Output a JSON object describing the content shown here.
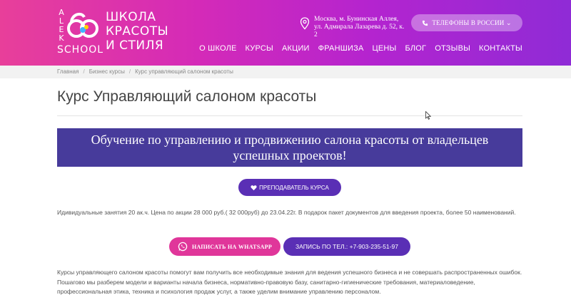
{
  "header": {
    "logo": {
      "vertical_letters": [
        "A",
        "L",
        "E",
        "K"
      ],
      "school": "SCHOOL",
      "title_lines": [
        "ШКОЛА",
        "КРАСОТЫ",
        "И СТИЛЯ"
      ]
    },
    "address": "Москва, м. Бунинская Аллея, ул. Адмирала Лазарева д. 52, к. 2",
    "phones_button": "ТЕЛЕФОНЫ В РОССИИ ⌄",
    "nav": [
      "О ШКОЛЕ",
      "КУРСЫ",
      "АКЦИИ",
      "ФРАНШИЗА",
      "ЦЕНЫ",
      "БЛОГ",
      "ОТЗЫВЫ",
      "КОНТАКТЫ"
    ]
  },
  "breadcrumbs": [
    "Главная",
    "Бизнес курсы",
    "Курс управляющий салоном красоты"
  ],
  "page_title": "Курс Управляющий салоном красоты",
  "banner": "Обучение по управлению и продвижению салона красоты от владельцев успешных проектов!",
  "teacher_button": "ПРЕПОДАВАТЕЛЬ КУРСА",
  "offer_text": "Идивидуальные занятия 20 ак.ч. Цена по акции 28 000 руб.( 32 000руб) до 23.04.22г. В подарок пакет документов для введения проекта, более 50 наименований.",
  "whatsapp_button": "НАПИСАТЬ НА WHATSAPP",
  "call_button": "ЗАПИСЬ ПО ТЕЛ.: +7-903-235-51-97",
  "description": "Курсы управляющего салоном красоты помогут вам получить все необходимые знания для ведения успешного бизнеса и не совершать распространенных ошибок. Пошагово мы разберем модели и варианты начала бизнеса, нормативно-правовую базу, санитарно-гигиенические требования, материаловедение, профессиональная этика, техника и психология продаж услуг, а также уделим внимание управлению персоналом.",
  "colors": {
    "header_gradient_start": "#e83f9a",
    "header_gradient_end": "#8f2bd6",
    "banner": "#473b9b",
    "purple_button": "#5a2fb5",
    "pink_button": "#e0369a"
  }
}
